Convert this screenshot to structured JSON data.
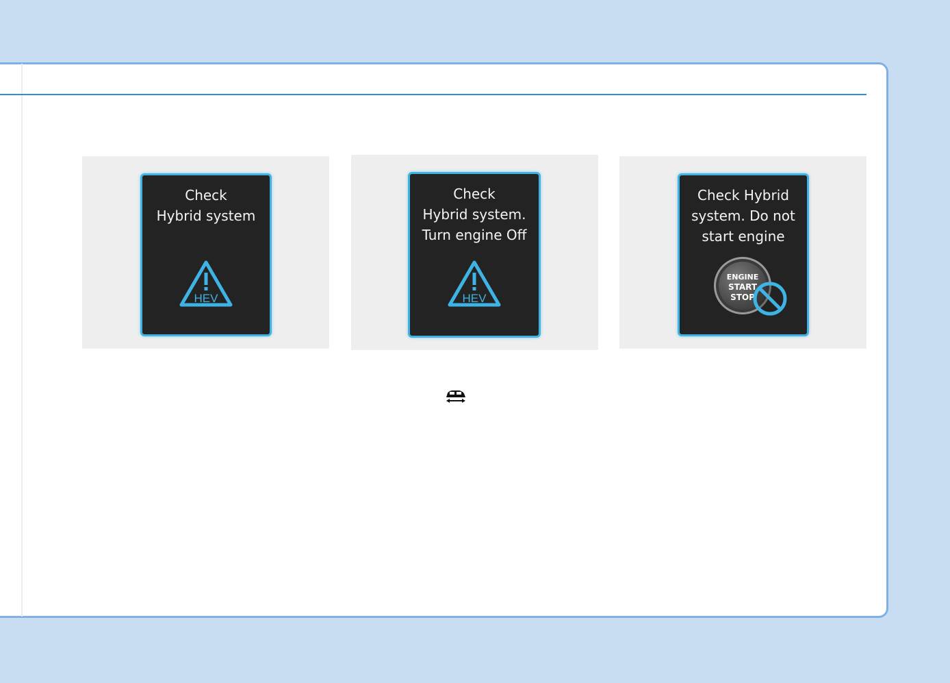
{
  "panels": [
    {
      "message_lines": [
        "Check",
        "Hybrid system"
      ],
      "icon": "hev-warning-icon",
      "icon_text": "HEV"
    },
    {
      "message_lines": [
        "Check",
        "Hybrid system.",
        "Turn engine Off"
      ],
      "icon": "hev-warning-icon",
      "icon_text": "HEV"
    },
    {
      "message_lines": [
        "Check Hybrid",
        "system. Do not",
        "start engine"
      ],
      "icon": "engine-start-stop-prohibited-icon",
      "button_lines": [
        "ENGINE",
        "START",
        "STOP"
      ]
    }
  ],
  "inline_icon": "car-drive-icon",
  "colors": {
    "background": "#c9ddf2",
    "card_border": "#7fb0e4",
    "header_rule": "#2f8ed6",
    "screen_border": "#3fb3e3",
    "screen_bg": "#232323",
    "panel_bg": "#eeeeee"
  }
}
